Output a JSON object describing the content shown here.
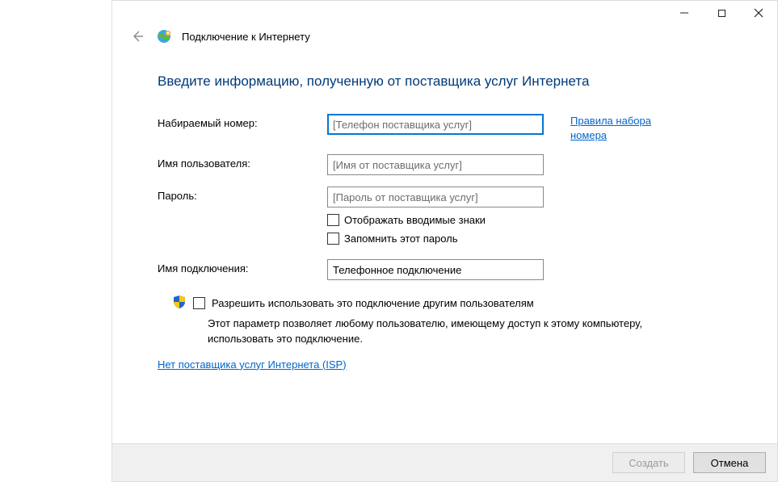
{
  "header": {
    "title": "Подключение к Интернету"
  },
  "heading": "Введите информацию, полученную от поставщика услуг Интернета",
  "fields": {
    "phone": {
      "label": "Набираемый номер:",
      "placeholder": "[Телефон поставщика услуг]",
      "value": ""
    },
    "username": {
      "label": "Имя пользователя:",
      "placeholder": "[Имя от поставщика услуг]",
      "value": ""
    },
    "password": {
      "label": "Пароль:",
      "placeholder": "[Пароль от поставщика услуг]",
      "value": ""
    },
    "connection_name": {
      "label": "Имя подключения:",
      "value": "Телефонное подключение"
    }
  },
  "checkboxes": {
    "show_chars": "Отображать вводимые знаки",
    "remember_pw": "Запомнить этот пароль",
    "allow_others": "Разрешить использовать это подключение другим пользователям"
  },
  "links": {
    "dialing_rules": "Правила набора номера",
    "no_isp": "Нет поставщика услуг Интернета (ISP)"
  },
  "descriptions": {
    "allow_others": "Этот параметр позволяет любому пользователю, имеющему доступ к этому компьютеру, использовать это подключение."
  },
  "buttons": {
    "create": "Создать",
    "cancel": "Отмена"
  }
}
